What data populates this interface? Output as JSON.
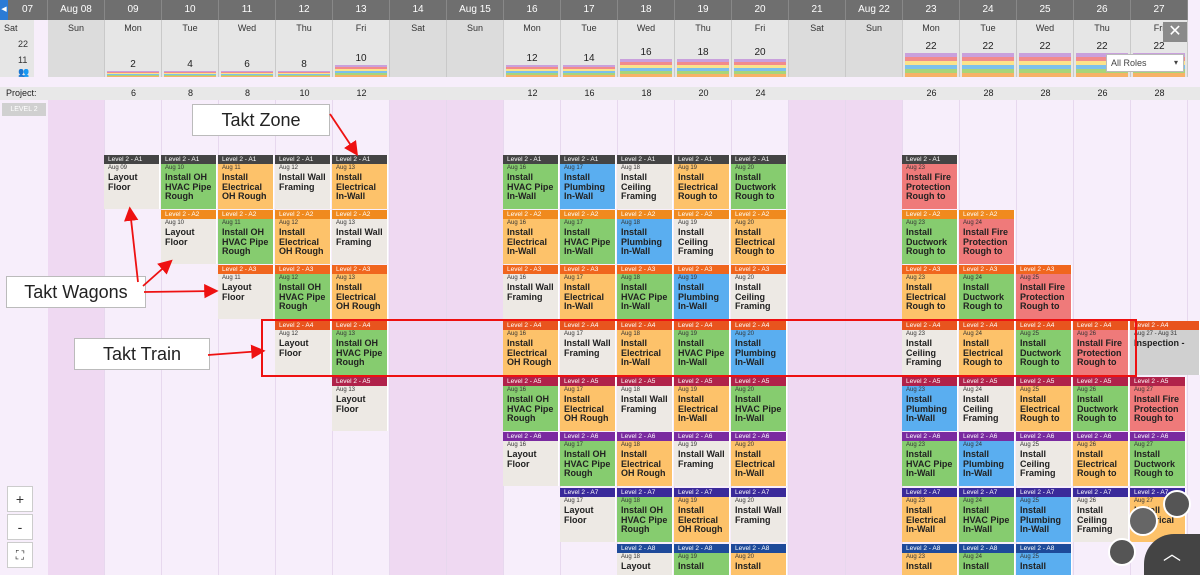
{
  "header": {
    "dates": [
      "07",
      "Aug 08",
      "09",
      "10",
      "11",
      "12",
      "13",
      "14",
      "Aug 15",
      "16",
      "17",
      "18",
      "19",
      "20",
      "21",
      "Aug 22",
      "23",
      "24",
      "25",
      "26",
      "27"
    ],
    "days": [
      "Sat",
      "Sun",
      "Mon",
      "Tue",
      "Wed",
      "Thu",
      "Fri",
      "Sat",
      "Sun",
      "Mon",
      "Tue",
      "Wed",
      "Thu",
      "Fri",
      "Sat",
      "Sun",
      "Mon",
      "Tue",
      "Wed",
      "Thu",
      "Fri"
    ],
    "counts": [
      "",
      "",
      "2",
      "4",
      "6",
      "8",
      "10",
      "",
      "",
      "12",
      "14",
      "16",
      "18",
      "20",
      "",
      "",
      "22",
      "22",
      "22",
      "22",
      "22"
    ],
    "axis": {
      "top": "22",
      "mid": "11"
    },
    "roles_select": "All Roles",
    "nav_left": "◀"
  },
  "project": {
    "label": "Project:",
    "values": [
      "",
      "",
      "6",
      "8",
      "8",
      "10",
      "12",
      "",
      "",
      "12",
      "16",
      "18",
      "20",
      "24",
      "",
      "",
      "26",
      "28",
      "28",
      "26",
      "28"
    ]
  },
  "level_tag": "LEVEL 2",
  "annotations": {
    "zone": "Takt Zone",
    "wagons": "Takt Wagons",
    "train": "Takt Train"
  },
  "zoom": {
    "plus": "+",
    "minus": "-",
    "fit": "⛶"
  },
  "cards": [
    {
      "col": 2,
      "row": 0,
      "zone": "Level 2 - A1",
      "date": "Aug 09",
      "task": "Layout Floor",
      "color": "white",
      "hc": "#444"
    },
    {
      "col": 3,
      "row": 0,
      "zone": "Level 2 - A1",
      "date": "Aug 10",
      "task": "Install OH HVAC Pipe Rough",
      "color": "green",
      "hc": "#444"
    },
    {
      "col": 4,
      "row": 0,
      "zone": "Level 2 - A1",
      "date": "Aug 11",
      "task": "Install Electrical OH Rough",
      "color": "orange",
      "hc": "#444"
    },
    {
      "col": 5,
      "row": 0,
      "zone": "Level 2 - A1",
      "date": "Aug 12",
      "task": "Install Wall Framing",
      "color": "white",
      "hc": "#444"
    },
    {
      "col": 6,
      "row": 0,
      "zone": "Level 2 - A1",
      "date": "Aug 13",
      "task": "Install Electrical In-Wall",
      "color": "orange",
      "hc": "#444"
    },
    {
      "col": 9,
      "row": 0,
      "zone": "Level 2 - A1",
      "date": "Aug 16",
      "task": "Install HVAC Pipe In-Wall",
      "color": "green",
      "hc": "#444"
    },
    {
      "col": 10,
      "row": 0,
      "zone": "Level 2 - A1",
      "date": "Aug 17",
      "task": "Install Plumbing In-Wall",
      "color": "blue",
      "hc": "#444"
    },
    {
      "col": 11,
      "row": 0,
      "zone": "Level 2 - A1",
      "date": "Aug 18",
      "task": "Install Ceiling Framing",
      "color": "white",
      "hc": "#444"
    },
    {
      "col": 12,
      "row": 0,
      "zone": "Level 2 - A1",
      "date": "Aug 19",
      "task": "Install Electrical Rough to",
      "color": "orange",
      "hc": "#444"
    },
    {
      "col": 13,
      "row": 0,
      "zone": "Level 2 - A1",
      "date": "Aug 20",
      "task": "Install Ductwork Rough to",
      "color": "green",
      "hc": "#444"
    },
    {
      "col": 16,
      "row": 0,
      "zone": "Level 2 - A1",
      "date": "Aug 23",
      "task": "Install Fire Protection Rough to",
      "color": "red",
      "hc": "#444"
    },
    {
      "col": 3,
      "row": 1,
      "zone": "Level 2 - A2",
      "date": "Aug 10",
      "task": "Layout Floor",
      "color": "white",
      "hc": "#f08a1e"
    },
    {
      "col": 4,
      "row": 1,
      "zone": "Level 2 - A2",
      "date": "Aug 11",
      "task": "Install OH HVAC Pipe Rough",
      "color": "green",
      "hc": "#f08a1e"
    },
    {
      "col": 5,
      "row": 1,
      "zone": "Level 2 - A2",
      "date": "Aug 12",
      "task": "Install Electrical OH Rough",
      "color": "orange",
      "hc": "#f08a1e"
    },
    {
      "col": 6,
      "row": 1,
      "zone": "Level 2 - A2",
      "date": "Aug 13",
      "task": "Install Wall Framing",
      "color": "white",
      "hc": "#f08a1e"
    },
    {
      "col": 9,
      "row": 1,
      "zone": "Level 2 - A2",
      "date": "Aug 16",
      "task": "Install Electrical In-Wall",
      "color": "orange",
      "hc": "#f08a1e"
    },
    {
      "col": 10,
      "row": 1,
      "zone": "Level 2 - A2",
      "date": "Aug 17",
      "task": "Install HVAC Pipe In-Wall",
      "color": "green",
      "hc": "#f08a1e"
    },
    {
      "col": 11,
      "row": 1,
      "zone": "Level 2 - A2",
      "date": "Aug 18",
      "task": "Install Plumbing In-Wall",
      "color": "blue",
      "hc": "#f08a1e"
    },
    {
      "col": 12,
      "row": 1,
      "zone": "Level 2 - A2",
      "date": "Aug 19",
      "task": "Install Ceiling Framing",
      "color": "white",
      "hc": "#f08a1e"
    },
    {
      "col": 13,
      "row": 1,
      "zone": "Level 2 - A2",
      "date": "Aug 20",
      "task": "Install Electrical Rough to",
      "color": "orange",
      "hc": "#f08a1e"
    },
    {
      "col": 16,
      "row": 1,
      "zone": "Level 2 - A2",
      "date": "Aug 23",
      "task": "Install Ductwork Rough to",
      "color": "green",
      "hc": "#f08a1e"
    },
    {
      "col": 17,
      "row": 1,
      "zone": "Level 2 - A2",
      "date": "Aug 24",
      "task": "Install Fire Protection Rough to",
      "color": "red",
      "hc": "#f08a1e"
    },
    {
      "col": 4,
      "row": 2,
      "zone": "Level 2 - A3",
      "date": "Aug 11",
      "task": "Layout Floor",
      "color": "white",
      "hc": "#f0661e"
    },
    {
      "col": 5,
      "row": 2,
      "zone": "Level 2 - A3",
      "date": "Aug 12",
      "task": "Install OH HVAC Pipe Rough",
      "color": "green",
      "hc": "#f0661e"
    },
    {
      "col": 6,
      "row": 2,
      "zone": "Level 2 - A3",
      "date": "Aug 13",
      "task": "Install Electrical OH Rough",
      "color": "orange",
      "hc": "#f0661e"
    },
    {
      "col": 9,
      "row": 2,
      "zone": "Level 2 - A3",
      "date": "Aug 16",
      "task": "Install Wall Framing",
      "color": "white",
      "hc": "#f0661e"
    },
    {
      "col": 10,
      "row": 2,
      "zone": "Level 2 - A3",
      "date": "Aug 17",
      "task": "Install Electrical In-Wall",
      "color": "orange",
      "hc": "#f0661e"
    },
    {
      "col": 11,
      "row": 2,
      "zone": "Level 2 - A3",
      "date": "Aug 18",
      "task": "Install HVAC Pipe In-Wall",
      "color": "green",
      "hc": "#f0661e"
    },
    {
      "col": 12,
      "row": 2,
      "zone": "Level 2 - A3",
      "date": "Aug 19",
      "task": "Install Plumbing In-Wall",
      "color": "blue",
      "hc": "#f0661e"
    },
    {
      "col": 13,
      "row": 2,
      "zone": "Level 2 - A3",
      "date": "Aug 20",
      "task": "Install Ceiling Framing",
      "color": "white",
      "hc": "#f0661e"
    },
    {
      "col": 16,
      "row": 2,
      "zone": "Level 2 - A3",
      "date": "Aug 23",
      "task": "Install Electrical Rough to",
      "color": "orange",
      "hc": "#f0661e"
    },
    {
      "col": 17,
      "row": 2,
      "zone": "Level 2 - A3",
      "date": "Aug 24",
      "task": "Install Ductwork Rough to",
      "color": "green",
      "hc": "#f0661e"
    },
    {
      "col": 18,
      "row": 2,
      "zone": "Level 2 - A3",
      "date": "Aug 25",
      "task": "Install Fire Protection Rough to",
      "color": "red",
      "hc": "#f0661e"
    },
    {
      "col": 5,
      "row": 3,
      "zone": "Level 2 - A4",
      "date": "Aug 12",
      "task": "Layout Floor",
      "color": "white",
      "hc": "#e8541e"
    },
    {
      "col": 6,
      "row": 3,
      "zone": "Level 2 - A4",
      "date": "Aug 13",
      "task": "Install OH HVAC Pipe Rough",
      "color": "green",
      "hc": "#e8541e"
    },
    {
      "col": 9,
      "row": 3,
      "zone": "Level 2 - A4",
      "date": "Aug 16",
      "task": "Install Electrical OH Rough",
      "color": "orange",
      "hc": "#e8541e"
    },
    {
      "col": 10,
      "row": 3,
      "zone": "Level 2 - A4",
      "date": "Aug 17",
      "task": "Install Wall Framing",
      "color": "white",
      "hc": "#e8541e"
    },
    {
      "col": 11,
      "row": 3,
      "zone": "Level 2 - A4",
      "date": "Aug 18",
      "task": "Install Electrical In-Wall",
      "color": "orange",
      "hc": "#e8541e"
    },
    {
      "col": 12,
      "row": 3,
      "zone": "Level 2 - A4",
      "date": "Aug 19",
      "task": "Install HVAC Pipe In-Wall",
      "color": "green",
      "hc": "#e8541e"
    },
    {
      "col": 13,
      "row": 3,
      "zone": "Level 2 - A4",
      "date": "Aug 20",
      "task": "Install Plumbing In-Wall",
      "color": "blue",
      "hc": "#e8541e"
    },
    {
      "col": 16,
      "row": 3,
      "zone": "Level 2 - A4",
      "date": "Aug 23",
      "task": "Install Ceiling Framing",
      "color": "white",
      "hc": "#e8541e"
    },
    {
      "col": 17,
      "row": 3,
      "zone": "Level 2 - A4",
      "date": "Aug 24",
      "task": "Install Electrical Rough to",
      "color": "orange",
      "hc": "#e8541e"
    },
    {
      "col": 18,
      "row": 3,
      "zone": "Level 2 - A4",
      "date": "Aug 25",
      "task": "Install Ductwork Rough to",
      "color": "green",
      "hc": "#e8541e"
    },
    {
      "col": 19,
      "row": 3,
      "zone": "Level 2 - A4",
      "date": "Aug 26",
      "task": "Install Fire Protection Rough to",
      "color": "red",
      "hc": "#e8541e"
    },
    {
      "col": 20,
      "row": 3,
      "zone": "Level 2 - A4",
      "date": "Aug 27 - Aug 31",
      "task": "Inspection - ",
      "color": "grey",
      "hc": "#e8541e"
    },
    {
      "col": 6,
      "row": 4,
      "zone": "Level 2 - A5",
      "date": "Aug 13",
      "task": "Layout Floor",
      "color": "white",
      "hc": "#b0224a"
    },
    {
      "col": 9,
      "row": 4,
      "zone": "Level 2 - A5",
      "date": "Aug 16",
      "task": "Install OH HVAC Pipe Rough",
      "color": "green",
      "hc": "#b0224a"
    },
    {
      "col": 10,
      "row": 4,
      "zone": "Level 2 - A5",
      "date": "Aug 17",
      "task": "Install Electrical OH Rough",
      "color": "orange",
      "hc": "#b0224a"
    },
    {
      "col": 11,
      "row": 4,
      "zone": "Level 2 - A5",
      "date": "Aug 18",
      "task": "Install Wall Framing",
      "color": "white",
      "hc": "#b0224a"
    },
    {
      "col": 12,
      "row": 4,
      "zone": "Level 2 - A5",
      "date": "Aug 19",
      "task": "Install Electrical In-Wall",
      "color": "orange",
      "hc": "#b0224a"
    },
    {
      "col": 13,
      "row": 4,
      "zone": "Level 2 - A5",
      "date": "Aug 20",
      "task": "Install HVAC Pipe In-Wall",
      "color": "green",
      "hc": "#b0224a"
    },
    {
      "col": 16,
      "row": 4,
      "zone": "Level 2 - A5",
      "date": "Aug 23",
      "task": "Install Plumbing In-Wall",
      "color": "blue",
      "hc": "#b0224a"
    },
    {
      "col": 17,
      "row": 4,
      "zone": "Level 2 - A5",
      "date": "Aug 24",
      "task": "Install Ceiling Framing",
      "color": "white",
      "hc": "#b0224a"
    },
    {
      "col": 18,
      "row": 4,
      "zone": "Level 2 - A5",
      "date": "Aug 25",
      "task": "Install Electrical Rough to",
      "color": "orange",
      "hc": "#b0224a"
    },
    {
      "col": 19,
      "row": 4,
      "zone": "Level 2 - A5",
      "date": "Aug 26",
      "task": "Install Ductwork Rough to",
      "color": "green",
      "hc": "#b0224a"
    },
    {
      "col": 20,
      "row": 4,
      "zone": "Level 2 - A5",
      "date": "Aug 27",
      "task": "Install Fire Protection Rough to",
      "color": "red",
      "hc": "#b0224a"
    },
    {
      "col": 9,
      "row": 5,
      "zone": "Level 2 - A6",
      "date": "Aug 16",
      "task": "Layout Floor",
      "color": "white",
      "hc": "#7a2aa0"
    },
    {
      "col": 10,
      "row": 5,
      "zone": "Level 2 - A6",
      "date": "Aug 17",
      "task": "Install OH HVAC Pipe Rough",
      "color": "green",
      "hc": "#7a2aa0"
    },
    {
      "col": 11,
      "row": 5,
      "zone": "Level 2 - A6",
      "date": "Aug 18",
      "task": "Install Electrical OH Rough",
      "color": "orange",
      "hc": "#7a2aa0"
    },
    {
      "col": 12,
      "row": 5,
      "zone": "Level 2 - A6",
      "date": "Aug 19",
      "task": "Install Wall Framing",
      "color": "white",
      "hc": "#7a2aa0"
    },
    {
      "col": 13,
      "row": 5,
      "zone": "Level 2 - A6",
      "date": "Aug 20",
      "task": "Install Electrical In-Wall",
      "color": "orange",
      "hc": "#7a2aa0"
    },
    {
      "col": 16,
      "row": 5,
      "zone": "Level 2 - A6",
      "date": "Aug 23",
      "task": "Install HVAC Pipe In-Wall",
      "color": "green",
      "hc": "#7a2aa0"
    },
    {
      "col": 17,
      "row": 5,
      "zone": "Level 2 - A6",
      "date": "Aug 24",
      "task": "Install Plumbing In-Wall",
      "color": "blue",
      "hc": "#7a2aa0"
    },
    {
      "col": 18,
      "row": 5,
      "zone": "Level 2 - A6",
      "date": "Aug 25",
      "task": "Install Ceiling Framing",
      "color": "white",
      "hc": "#7a2aa0"
    },
    {
      "col": 19,
      "row": 5,
      "zone": "Level 2 - A6",
      "date": "Aug 26",
      "task": "Install Electrical Rough to",
      "color": "orange",
      "hc": "#7a2aa0"
    },
    {
      "col": 20,
      "row": 5,
      "zone": "Level 2 - A6",
      "date": "Aug 27",
      "task": "Install Ductwork Rough to",
      "color": "green",
      "hc": "#7a2aa0"
    },
    {
      "col": 10,
      "row": 6,
      "zone": "Level 2 - A7",
      "date": "Aug 17",
      "task": "Layout Floor",
      "color": "white",
      "hc": "#3a2a9a"
    },
    {
      "col": 11,
      "row": 6,
      "zone": "Level 2 - A7",
      "date": "Aug 18",
      "task": "Install OH HVAC Pipe Rough",
      "color": "green",
      "hc": "#3a2a9a"
    },
    {
      "col": 12,
      "row": 6,
      "zone": "Level 2 - A7",
      "date": "Aug 19",
      "task": "Install Electrical OH Rough",
      "color": "orange",
      "hc": "#3a2a9a"
    },
    {
      "col": 13,
      "row": 6,
      "zone": "Level 2 - A7",
      "date": "Aug 20",
      "task": "Install Wall Framing",
      "color": "white",
      "hc": "#3a2a9a"
    },
    {
      "col": 16,
      "row": 6,
      "zone": "Level 2 - A7",
      "date": "Aug 23",
      "task": "Install Electrical In-Wall",
      "color": "orange",
      "hc": "#3a2a9a"
    },
    {
      "col": 17,
      "row": 6,
      "zone": "Level 2 - A7",
      "date": "Aug 24",
      "task": "Install HVAC Pipe In-Wall",
      "color": "green",
      "hc": "#3a2a9a"
    },
    {
      "col": 18,
      "row": 6,
      "zone": "Level 2 - A7",
      "date": "Aug 25",
      "task": "Install Plumbing In-Wall",
      "color": "blue",
      "hc": "#3a2a9a"
    },
    {
      "col": 19,
      "row": 6,
      "zone": "Level 2 - A7",
      "date": "Aug 26",
      "task": "Install Ceiling Framing",
      "color": "white",
      "hc": "#3a2a9a"
    },
    {
      "col": 20,
      "row": 6,
      "zone": "Level 2 - A7",
      "date": "Aug 27",
      "task": "Install Electrical ",
      "color": "orange",
      "hc": "#3a2a9a"
    },
    {
      "col": 11,
      "row": 7,
      "zone": "Level 2 - A8",
      "date": "Aug 18",
      "task": "Layout",
      "color": "white",
      "hc": "#1e4a9a"
    },
    {
      "col": 12,
      "row": 7,
      "zone": "Level 2 - A8",
      "date": "Aug 19",
      "task": "Install",
      "color": "green",
      "hc": "#1e4a9a"
    },
    {
      "col": 13,
      "row": 7,
      "zone": "Level 2 - A8",
      "date": "Aug 20",
      "task": "Install",
      "color": "orange",
      "hc": "#1e4a9a"
    },
    {
      "col": 16,
      "row": 7,
      "zone": "Level 2 - A8",
      "date": "Aug 23",
      "task": "Install",
      "color": "orange",
      "hc": "#1e4a9a"
    },
    {
      "col": 17,
      "row": 7,
      "zone": "Level 2 - A8",
      "date": "Aug 24",
      "task": "Install",
      "color": "green",
      "hc": "#1e4a9a"
    },
    {
      "col": 18,
      "row": 7,
      "zone": "Level 2 - A8",
      "date": "Aug 25",
      "task": "Install",
      "color": "blue",
      "hc": "#1e4a9a"
    }
  ]
}
